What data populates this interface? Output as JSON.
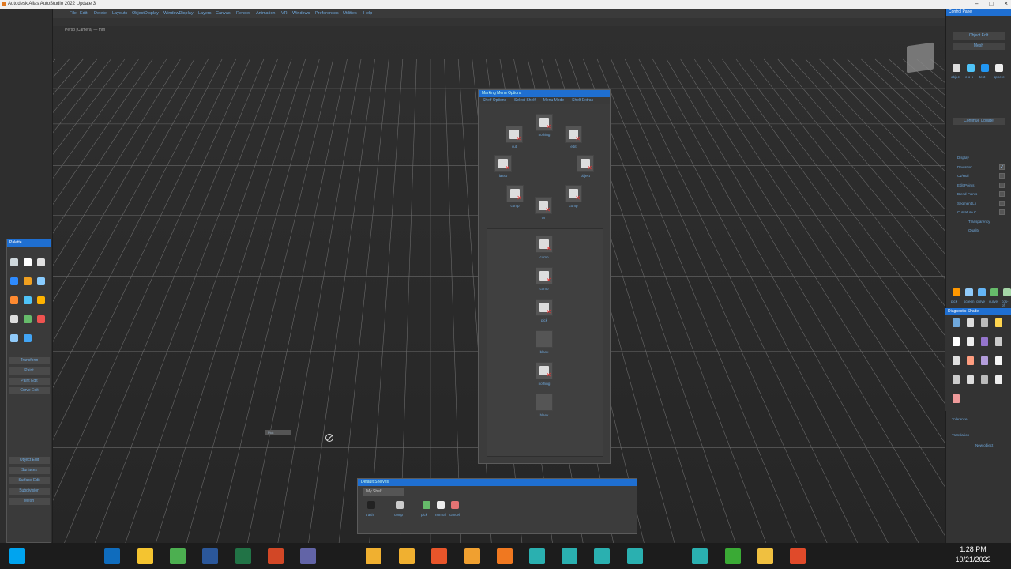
{
  "app": {
    "title": "Autodesk Alias AutoStudio 2022 Update 3"
  },
  "menus": [
    "File",
    "Edit",
    "Delete",
    "Layouts",
    "ObjectDisplay",
    "WindowDisplay",
    "Layers",
    "Canvas",
    "Render",
    "Animation",
    "VR",
    "Windows",
    "Preferences",
    "Utilities",
    "Help"
  ],
  "viewport": {
    "label": "Persp [Camera] — mm"
  },
  "palette": {
    "title": "Palette",
    "sections": [
      "Transform",
      "Paint",
      "Paint Edit",
      "Curve Edit",
      "Object Edit",
      "Surfaces",
      "Surface Edit",
      "Subdivision",
      "Mesh"
    ]
  },
  "control_panel": {
    "title": "Control Panel",
    "buttons": [
      "Object Edit",
      "Mesh"
    ],
    "quick_icons": [
      "object",
      "c-o-s",
      "text",
      "sphere"
    ],
    "display_header": "Continue Update",
    "options": [
      {
        "label": "Display",
        "checked": false
      },
      {
        "label": "Deviation",
        "checked": true
      },
      {
        "label": "Cv/Hull",
        "checked": false
      },
      {
        "label": "Edit Points",
        "checked": false
      },
      {
        "label": "Blend Points",
        "checked": false
      },
      {
        "label": "Segment Ln",
        "checked": false
      },
      {
        "label": "Curvature C",
        "checked": false
      }
    ],
    "sub": [
      "Transparency",
      "Quality"
    ],
    "bottom_icons": [
      "pick",
      "screen",
      "curve",
      "curve",
      "cos-off"
    ]
  },
  "diagnostic": {
    "title": "Diagnostic Shade",
    "tolerance_label": "Tolerance",
    "translation_label": "Translation",
    "new_object_label": "New object"
  },
  "marking_menu": {
    "title": "Marking Menu Options",
    "tabs": [
      "Shelf Options",
      "Select Shelf",
      "Menu Mode",
      "Shelf Extras"
    ],
    "top_icons": [
      {
        "label": "cut"
      },
      {
        "label": "nothing"
      },
      {
        "label": "edit"
      },
      {
        "label": "lasso"
      },
      {
        "label": "object"
      },
      {
        "label": "comp"
      },
      {
        "label": "cv"
      },
      {
        "label": "comp"
      }
    ],
    "list_icons": [
      {
        "label": "comp"
      },
      {
        "label": "comp"
      },
      {
        "label": "pick"
      },
      {
        "label": "blank"
      },
      {
        "label": "nothing"
      },
      {
        "label": "blank"
      }
    ]
  },
  "shelf": {
    "title": "Default Shelves",
    "tab": "My Shelf",
    "items": [
      "trash",
      "comp",
      "pick",
      "normal",
      "cancel"
    ]
  },
  "taskbar": {
    "time": "1:28 PM",
    "date": "10/21/2022"
  },
  "tooltip": {
    "text": "Pick"
  }
}
